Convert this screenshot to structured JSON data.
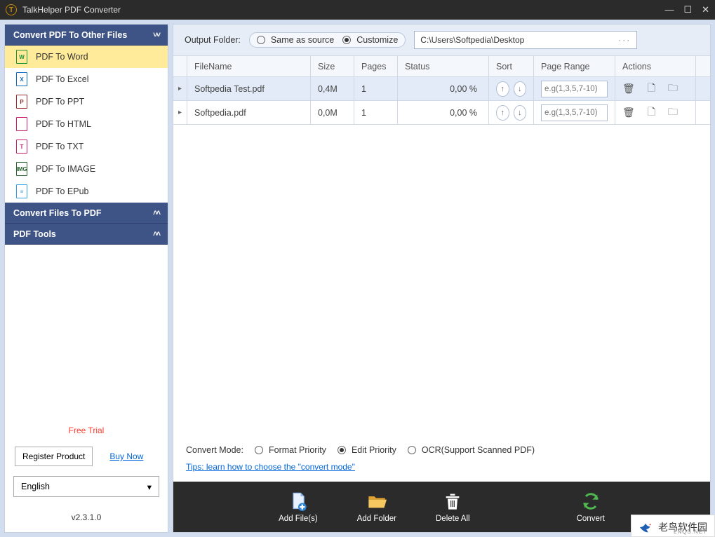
{
  "app": {
    "title": "TalkHelper PDF Converter"
  },
  "sidebar": {
    "panels": {
      "convert_to": "Convert PDF To Other Files",
      "convert_from": "Convert Files To PDF",
      "tools": "PDF Tools"
    },
    "items": [
      {
        "label": "PDF To Word",
        "icon": "W",
        "color": "#1a8f3c",
        "selected": true
      },
      {
        "label": "PDF To Excel",
        "icon": "X",
        "color": "#0c6bbd",
        "selected": false
      },
      {
        "label": "PDF To PPT",
        "icon": "P",
        "color": "#9a2c2c",
        "selected": false
      },
      {
        "label": "PDF To HTML",
        "icon": "</>",
        "color": "#c81e6e",
        "selected": false
      },
      {
        "label": "PDF To TXT",
        "icon": "T",
        "color": "#c81e6e",
        "selected": false
      },
      {
        "label": "PDF To IMAGE",
        "icon": "IMG",
        "color": "#2b6430",
        "selected": false
      },
      {
        "label": "PDF To EPub",
        "icon": "≡",
        "color": "#2f9fe8",
        "selected": false
      }
    ],
    "free_trial": "Free Trial",
    "register": "Register Product",
    "buy": "Buy Now",
    "language": "English",
    "version": "v2.3.1.0"
  },
  "output": {
    "label": "Output Folder:",
    "opt_same": "Same as source",
    "opt_custom": "Customize",
    "path": "C:\\Users\\Softpedia\\Desktop"
  },
  "table": {
    "headers": {
      "name": "FileName",
      "size": "Size",
      "pages": "Pages",
      "status": "Status",
      "sort": "Sort",
      "range": "Page Range",
      "actions": "Actions"
    },
    "range_placeholder": "e.g(1,3,5,7-10)",
    "rows": [
      {
        "name": "Softpedia Test.pdf",
        "size": "0,4M",
        "pages": "1",
        "status": "0,00 %",
        "selected": true
      },
      {
        "name": "Softpedia.pdf",
        "size": "0,0M",
        "pages": "1",
        "status": "0,00 %",
        "selected": false
      }
    ]
  },
  "mode": {
    "label": "Convert Mode:",
    "format": "Format Priority",
    "edit": "Edit Priority",
    "ocr": "OCR(Support Scanned PDF)",
    "tips": "Tips: learn how to choose the \"convert mode\""
  },
  "actions": {
    "add_files": "Add File(s)",
    "add_folder": "Add Folder",
    "delete_all": "Delete All",
    "convert": "Convert"
  },
  "watermark": {
    "text": "老鸟软件园",
    "sub": "LNQS.NET"
  }
}
